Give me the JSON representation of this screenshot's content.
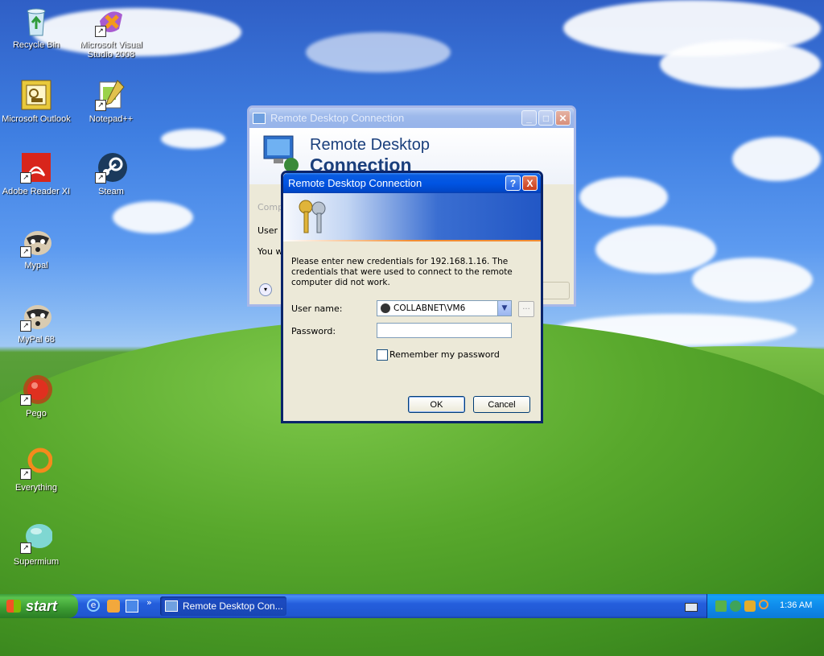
{
  "desktop": {
    "icons": [
      {
        "label": "Recycle Bin",
        "icon": "recycle-bin-icon"
      },
      {
        "label": "Microsoft Visual Studio 2008",
        "icon": "visual-studio-icon"
      },
      {
        "label": "Microsoft Outlook",
        "icon": "outlook-icon"
      },
      {
        "label": "Notepad++",
        "icon": "notepad-plus-plus-icon"
      },
      {
        "label": "Adobe Reader XI",
        "icon": "adobe-reader-icon"
      },
      {
        "label": "Steam",
        "icon": "steam-icon"
      },
      {
        "label": "Mypal",
        "icon": "mypal-icon"
      },
      {
        "label": "MyPal 68",
        "icon": "mypal-68-icon"
      },
      {
        "label": "Pego",
        "icon": "pego-icon"
      },
      {
        "label": "Everything",
        "icon": "everything-icon"
      },
      {
        "label": "Supermium",
        "icon": "supermium-icon"
      }
    ]
  },
  "back_window": {
    "title": "Remote Desktop Connection",
    "banner_line1": "Remote Desktop",
    "banner_line2": "Connection",
    "partial_label1": "Comp",
    "partial_label2": "User n",
    "partial_label3": "You w"
  },
  "dialog": {
    "title": "Remote Desktop Connection",
    "help_glyph": "?",
    "close_glyph": "X",
    "message": "Please enter new credentials for 192.168.1.16. The credentials that were used to connect to the remote computer did not work.",
    "username_label": "User name:",
    "username_value": "COLLABNET\\VM6",
    "browse_label": "...",
    "password_label": "Password:",
    "password_value": "",
    "remember_label": "Remember my password",
    "remember_checked": false,
    "ok_label": "OK",
    "cancel_label": "Cancel"
  },
  "taskbar": {
    "start_label": "start",
    "quicklaunch": [
      "ie-icon",
      "media-icon",
      "show-desktop-icon"
    ],
    "chevron": "»",
    "task_label": "Remote Desktop Con...",
    "clock": "1:36 AM"
  },
  "colors": {
    "titlebar_active": "#0054e3",
    "dialog_bg": "#ece9d8",
    "taskbar": "#245edc",
    "start_button": "#3b9b32"
  }
}
